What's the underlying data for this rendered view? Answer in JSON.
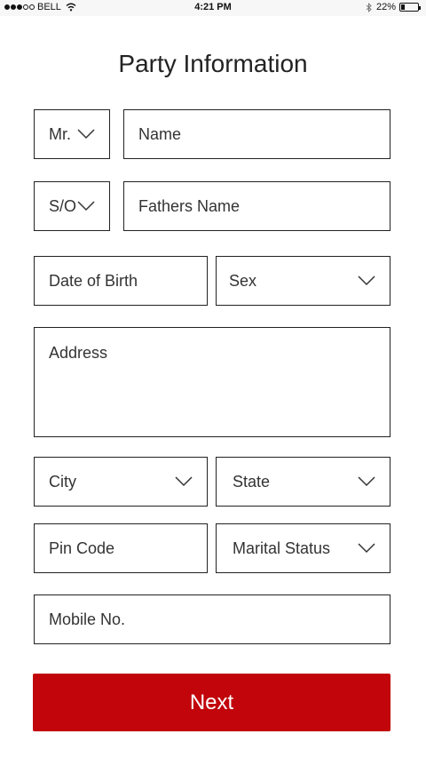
{
  "status_bar": {
    "carrier": "BELL",
    "time": "4:21 PM",
    "battery": "22%",
    "battery_level": 0.22,
    "signal_filled": 3,
    "signal_total": 5
  },
  "title": "Party Information",
  "form": {
    "salutation": "Mr.",
    "name_placeholder": "Name",
    "relation": "S/O",
    "fathers_name_placeholder": "Fathers Name",
    "dob_placeholder": "Date of Birth",
    "sex_placeholder": "Sex",
    "address_placeholder": "Address",
    "city_placeholder": "City",
    "state_placeholder": "State",
    "pin_placeholder": "Pin Code",
    "marital_placeholder": "Marital Status",
    "mobile_placeholder": "Mobile No."
  },
  "next_label": "Next",
  "colors": {
    "accent": "#c1050b",
    "border": "#222222",
    "status_bar_bg": "#f7f7f7"
  }
}
